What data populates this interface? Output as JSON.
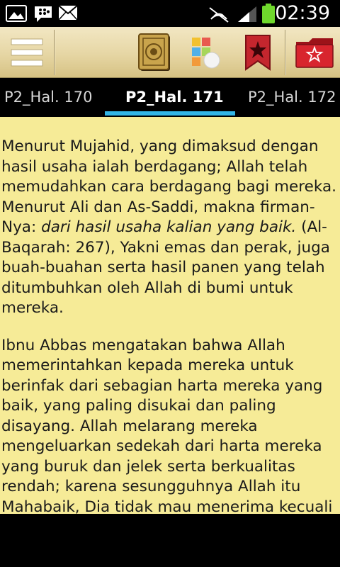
{
  "status_bar": {
    "time": "02:39",
    "icons": [
      "gallery-icon",
      "bbm-icon",
      "email-icon",
      "no-signal-icon",
      "signal-icon",
      "battery-icon"
    ],
    "battery_color": "#6fd82c"
  },
  "action_bar": {
    "buttons": [
      "menu-icon",
      "quran-book-icon",
      "color-palette-icon",
      "bookmark-icon",
      "bookmarks-folder-icon"
    ]
  },
  "tabs": {
    "prev": "P2_Hal. 170",
    "current": "P2_Hal. 171",
    "next": "P2_Hal. 172",
    "indicator_color": "#33b5e5"
  },
  "content": {
    "p1": {
      "l1": "Menurut Mujahid, yang dimaksud dengan",
      "l2": "hasil usaha ialah berdagang; Allah telah",
      "l3": "memudahkan cara berdagang bagi mereka.",
      "l4": "Menurut Ali dan As-Saddi, makna firman-",
      "l5_pre": "Nya: ",
      "l5_em": "dari hasil usaha kalian yang baik.",
      "l5_post": " (Al-",
      "l6": "Baqarah: 267), Yakni emas dan perak, juga",
      "l7": "buah-buahan serta hasil panen yang telah",
      "l8": "ditumbuhkan oleh Allah di bumi untuk",
      "l9": "mereka."
    },
    "p2": {
      "l1": "Ibnu Abbas mengatakan bahwa Allah",
      "l2": "memerintahkan kepada mereka untuk",
      "l3": "berinfak dari sebagian harta mereka yang",
      "l4": "baik, yang paling disukai dan paling",
      "l5": "disayang. Allah melarang mereka",
      "l6": "mengeluarkan sedekah dari harta mereka",
      "l7": "yang buruk dan jelek serta berkualitas",
      "l8": "rendah; karena sesungguhnya Allah itu",
      "l9": "Mahabaik, Dia tidak mau menerima kecuali"
    },
    "background": "#f6eb97"
  }
}
